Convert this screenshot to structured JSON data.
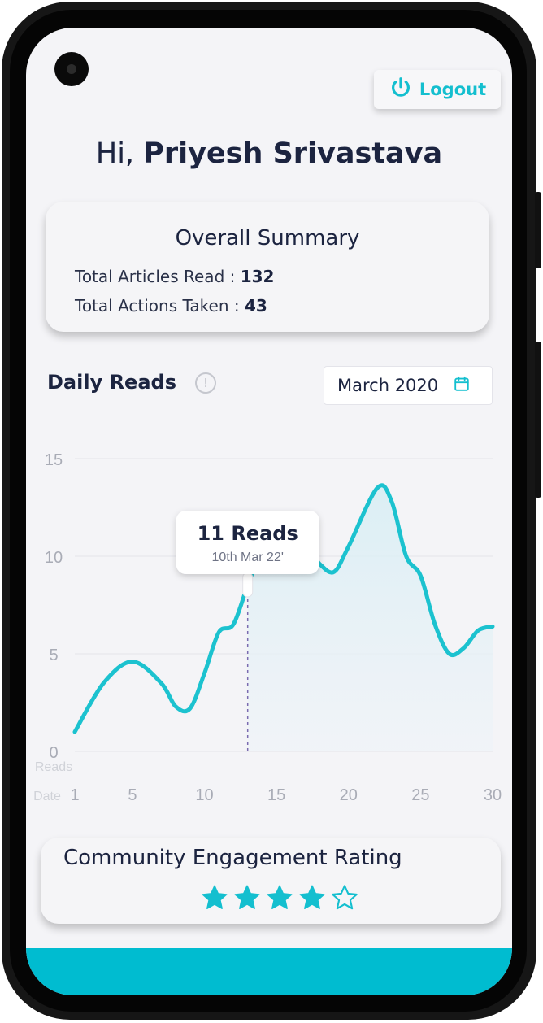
{
  "header": {
    "logout_label": "Logout"
  },
  "greeting": {
    "prefix": "Hi, ",
    "name": "Priyesh Srivastava"
  },
  "summary": {
    "title": "Overall Summary",
    "rows": [
      {
        "label": "Total Articles Read",
        "sep": " : ",
        "value": "132"
      },
      {
        "label": "Total Actions Taken",
        "sep": " : ",
        "value": "43"
      }
    ]
  },
  "daily_reads": {
    "title": "Daily Reads",
    "info_icon": "info-icon",
    "date_picker": {
      "value": "March 2020",
      "icon": "calendar-icon"
    }
  },
  "chart_data": {
    "type": "area",
    "x": [
      1,
      3,
      5,
      7,
      8,
      9,
      10,
      11,
      12,
      13,
      14,
      15,
      17,
      18,
      19,
      20,
      22,
      23,
      24,
      25,
      26,
      27,
      28,
      29,
      30
    ],
    "y": [
      1.0,
      3.5,
      4.6,
      3.5,
      2.3,
      2.2,
      4.0,
      6.1,
      6.5,
      8.5,
      10.3,
      10.6,
      10.5,
      9.6,
      9.2,
      10.5,
      13.5,
      12.8,
      10.0,
      9.0,
      6.5,
      5.0,
      5.3,
      6.2,
      6.4
    ],
    "xlabel": "Date",
    "ylabel": "Reads",
    "xticks": [
      "1",
      "5",
      "10",
      "15",
      "20",
      "25",
      "30"
    ],
    "yticks": [
      "0",
      "5",
      "10",
      "15"
    ],
    "xlim": [
      1,
      30
    ],
    "ylim": [
      0,
      15
    ],
    "grid": true,
    "series_color": "#1cc2cf",
    "tooltip": {
      "title": "11 Reads",
      "subtitle": "10th Mar 22'",
      "x": 13
    }
  },
  "rating": {
    "title": "Community Engagement Rating",
    "value": 4,
    "max": 5,
    "color": "#14bfcf"
  }
}
